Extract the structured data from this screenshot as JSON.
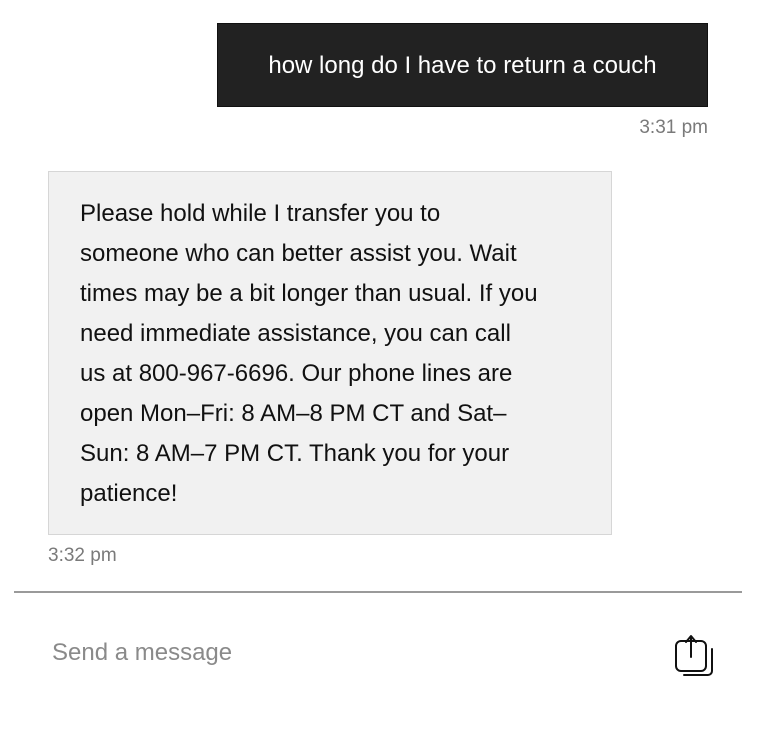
{
  "conversation": {
    "user_message": {
      "text": "how long do I have to return a couch",
      "time": "3:31 pm"
    },
    "agent_message": {
      "lines": [
        "Please hold while I transfer you to",
        "someone who can better assist you. Wait",
        "times may be a bit longer than usual. If you",
        "need immediate assistance, you can call",
        "us at 800-967-6696. Our phone lines are",
        "open Mon–Fri: 8 AM–8 PM CT and Sat–",
        "Sun: 8 AM–7 PM CT. Thank you for your",
        "patience!"
      ],
      "time": "3:32 pm"
    }
  },
  "composer": {
    "placeholder": "Send a message",
    "value": "",
    "send_icon": "send-icon"
  },
  "colors": {
    "user_bubble": "#222222",
    "agent_bubble": "#f1f1f1",
    "timestamp": "#7a7a7a",
    "divider": "#9a9a9a"
  }
}
